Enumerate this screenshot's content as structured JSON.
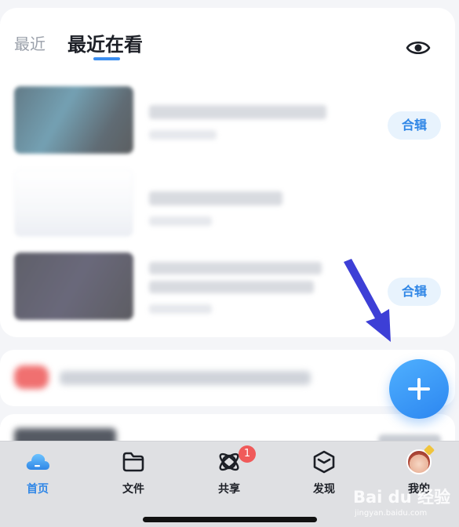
{
  "header": {
    "tabs": [
      {
        "label": "最近",
        "active": false
      },
      {
        "label": "最近在看",
        "active": true
      }
    ],
    "visibility_icon": "eye-icon"
  },
  "recent_items": [
    {
      "thumbnail": "blurred-dark-teal",
      "action_label": "合辑"
    },
    {
      "thumbnail": "blurred-white",
      "action_label": ""
    },
    {
      "thumbnail": "blurred-dark-purple",
      "action_label": "合辑"
    }
  ],
  "fab": {
    "icon": "plus-icon",
    "color": "#2c86f0"
  },
  "tabbar": {
    "items": [
      {
        "label": "首页",
        "icon": "cloud-icon",
        "active": true
      },
      {
        "label": "文件",
        "icon": "folder-icon",
        "active": false
      },
      {
        "label": "共享",
        "icon": "share-orbit-icon",
        "active": false,
        "badge": "1"
      },
      {
        "label": "发现",
        "icon": "cube-icon",
        "active": false
      },
      {
        "label": "我的",
        "icon": "avatar",
        "active": false
      }
    ]
  },
  "watermark": {
    "main": "Bai du 经验",
    "sub": "jingyan.baidu.com"
  },
  "colors": {
    "accent": "#2f86e6",
    "chip_bg": "#e8f3fd",
    "badge": "#f05a5a",
    "arrow": "#3d3fd6"
  }
}
